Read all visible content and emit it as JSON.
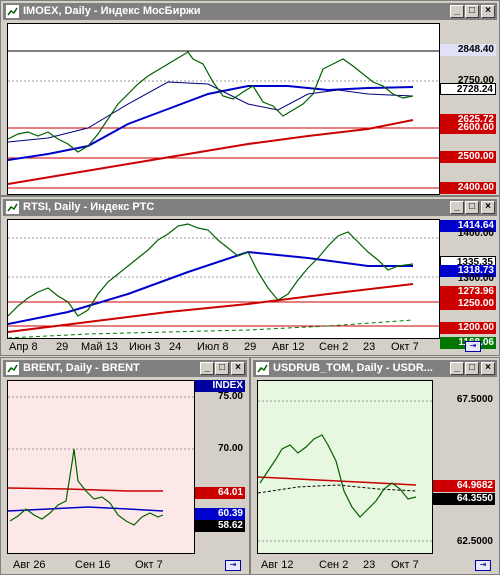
{
  "windows": {
    "imoex": {
      "title": "IMOEX, Daily - Индекс МосБиржи",
      "price_labels": [
        "2848.40",
        "2750.00",
        "2728.24",
        "2625.72",
        "2600.00",
        "2500.00",
        "2400.00"
      ],
      "dates": [
        "Апр 8",
        "29",
        "Май 13",
        "Июн 3",
        "24",
        "Июл 8",
        "29",
        "Авг 12",
        "Сен 2",
        "23",
        "Окт 7"
      ]
    },
    "rtsi": {
      "title": "RTSI, Daily - Индекс РТС",
      "price_labels": [
        "1414.64",
        "1400.00",
        "1335.35",
        "1318.73",
        "1300.00",
        "1273.96",
        "1250.00",
        "1200.00",
        "1168.06"
      ],
      "dates": [
        "Апр 8",
        "29",
        "Май 13",
        "Июн 3",
        "24",
        "Июл 8",
        "29",
        "Авг 12",
        "Сен 2",
        "23",
        "Окт 7"
      ]
    },
    "brent": {
      "title": "BRENT, Daily - BRENT",
      "index_tag": "INDEX",
      "price_labels": [
        "75.00",
        "70.00",
        "64.01",
        "60.39",
        "58.62"
      ],
      "dates": [
        "Авг 26",
        "Сен 16",
        "Окт 7"
      ]
    },
    "usdrub": {
      "title": "USDRUB_TOM, Daily - USDR...",
      "price_labels": [
        "67.5000",
        "64.9682",
        "64.3550",
        "62.5000"
      ],
      "dates": [
        "Авг 12",
        "Сен 2",
        "23",
        "Окт 7"
      ]
    }
  },
  "colors": {
    "red_line": "#cc0000",
    "blue_line": "#0000cc",
    "green_line": "#007700",
    "brent_bg": "#fde8e8",
    "usd_bg": "#e8f8e0"
  }
}
